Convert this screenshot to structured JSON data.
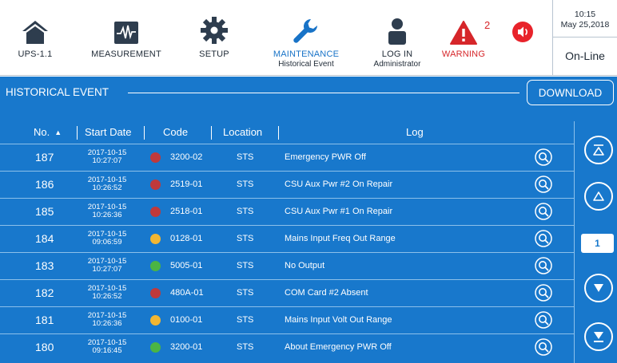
{
  "nav": {
    "items": [
      {
        "label": "UPS-1.1",
        "sub": "",
        "icon": "home-icon"
      },
      {
        "label": "MEASUREMENT",
        "sub": "",
        "icon": "waveform-icon"
      },
      {
        "label": "SETUP",
        "sub": "",
        "icon": "gear-icon"
      },
      {
        "label": "MAINTENANCE",
        "sub": "Historical Event",
        "icon": "wrench-icon"
      },
      {
        "label": "LOG IN",
        "sub": "Administrator",
        "icon": "user-icon"
      },
      {
        "label": "WARNING",
        "sub": "",
        "icon": "warning-icon",
        "badge": "2"
      },
      {
        "label": "",
        "sub": "",
        "icon": "speaker-icon"
      }
    ]
  },
  "status": {
    "time": "10:15",
    "date": "May 25,2018",
    "mode": "On-Line"
  },
  "panel": {
    "title": "HISTORICAL EVENT",
    "download_label": "DOWNLOAD"
  },
  "table": {
    "headers": {
      "no": "No.",
      "start_date": "Start Date",
      "code": "Code",
      "location": "Location",
      "log": "Log"
    },
    "sort_arrow": "▲",
    "rows": [
      {
        "no": "187",
        "date": "2017-10-15",
        "time": "10:27:07",
        "severity": "red",
        "code": "3200-02",
        "location": "STS",
        "log": "Emergency PWR Off"
      },
      {
        "no": "186",
        "date": "2017-10-15",
        "time": "10:26:52",
        "severity": "red",
        "code": "2519-01",
        "location": "STS",
        "log": "CSU Aux Pwr #2 On Repair"
      },
      {
        "no": "185",
        "date": "2017-10-15",
        "time": "10:26:36",
        "severity": "red",
        "code": "2518-01",
        "location": "STS",
        "log": "CSU Aux Pwr #1 On Repair"
      },
      {
        "no": "184",
        "date": "2017-10-15",
        "time": "09:06:59",
        "severity": "yellow",
        "code": "0128-01",
        "location": "STS",
        "log": "Mains Input Freq Out Range"
      },
      {
        "no": "183",
        "date": "2017-10-15",
        "time": "10:27:07",
        "severity": "green",
        "code": "5005-01",
        "location": "STS",
        "log": "No Output"
      },
      {
        "no": "182",
        "date": "2017-10-15",
        "time": "10:26:52",
        "severity": "red",
        "code": "480A-01",
        "location": "STS",
        "log": "COM Card #2 Absent"
      },
      {
        "no": "181",
        "date": "2017-10-15",
        "time": "10:26:36",
        "severity": "yellow",
        "code": "0100-01",
        "location": "STS",
        "log": "Mains Input Volt Out Range"
      },
      {
        "no": "180",
        "date": "2017-10-15",
        "time": "09:16:45",
        "severity": "green",
        "code": "3200-01",
        "location": "STS",
        "log": "About Emergency PWR Off"
      }
    ]
  },
  "pagination": {
    "current_page": "1"
  },
  "colors": {
    "panel_blue": "#1878cc",
    "active_blue": "#1873c7",
    "warning_red": "#d6262a",
    "dot_red": "#c0393b",
    "dot_yellow": "#f2b632",
    "dot_green": "#4bb543"
  }
}
